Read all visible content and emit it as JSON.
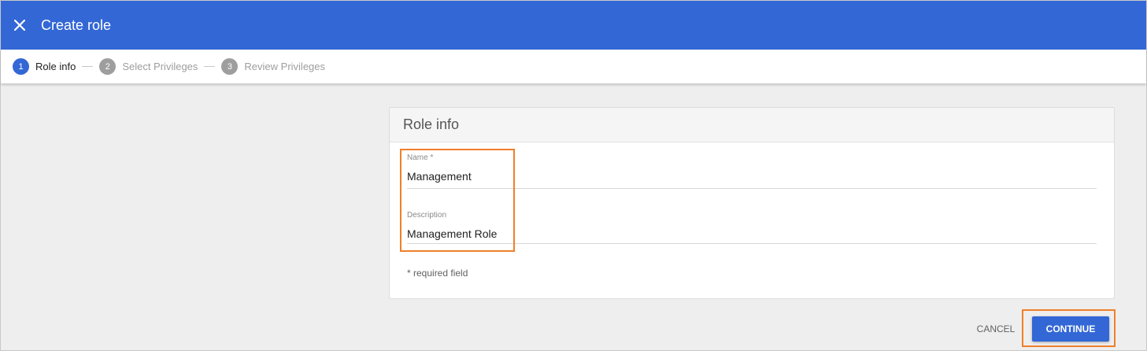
{
  "header": {
    "title": "Create role",
    "close_icon": "close-icon",
    "color": "#3367d6"
  },
  "stepper": {
    "steps": [
      {
        "number": "1",
        "label": "Role info",
        "active": true
      },
      {
        "number": "2",
        "label": "Select Privileges",
        "active": false
      },
      {
        "number": "3",
        "label": "Review Privileges",
        "active": false
      }
    ]
  },
  "card": {
    "title": "Role info",
    "name_field": {
      "label": "Name *",
      "value": "Management"
    },
    "description_field": {
      "label": "Description",
      "value": "Management Role"
    },
    "required_note": "* required field"
  },
  "actions": {
    "cancel_label": "CANCEL",
    "continue_label": "CONTINUE"
  },
  "colors": {
    "accent": "#3367d6",
    "highlight": "#f07f28",
    "inactive_step": "#9e9e9e"
  }
}
